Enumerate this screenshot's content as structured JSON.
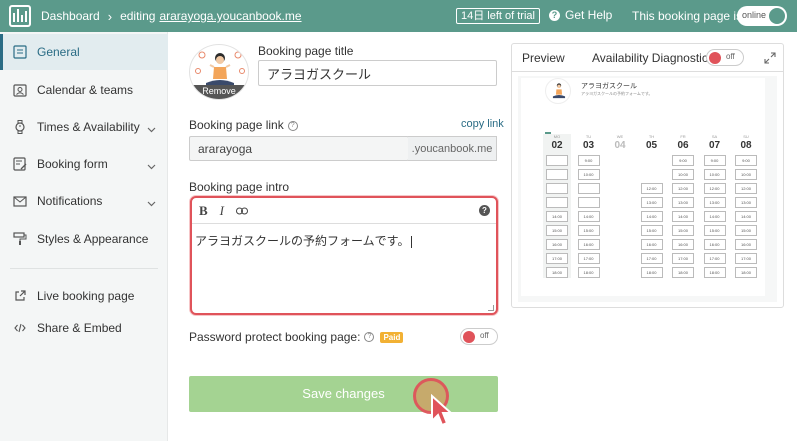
{
  "topbar": {
    "dashboard": "Dashboard",
    "editing": "editing",
    "site": "ararayoga.youcanbook.me",
    "trial": "14日 left of trial",
    "help": "Get Help",
    "booking_page_is": "This booking page is",
    "online": "online"
  },
  "sidebar": {
    "items": [
      {
        "label": "General"
      },
      {
        "label": "Calendar & teams"
      },
      {
        "label": "Times & Availability"
      },
      {
        "label": "Booking form"
      },
      {
        "label": "Notifications"
      },
      {
        "label": "Styles & Appearance"
      },
      {
        "label": "Live booking page"
      },
      {
        "label": "Share & Embed"
      }
    ]
  },
  "form": {
    "remove": "Remove",
    "title_label": "Booking page title",
    "title_value": "アラヨガスクール",
    "link_label": "Booking page link",
    "copy_link": "copy link",
    "link_value": "ararayoga",
    "link_suffix": ".youcanbook.me",
    "intro_label": "Booking page intro",
    "intro_text": "アラヨガスクールの予約フォームです。",
    "password_label": "Password protect booking page:",
    "paid": "Paid",
    "password_toggle": "off",
    "save": "Save changes"
  },
  "preview": {
    "tab": "Preview",
    "diagnostics": "Availability Diagnostics",
    "diagnostics_toggle": "off",
    "page_title": "アラヨガスクール",
    "page_sub": "アラヨガスクールの予約フォームです。",
    "days": [
      {
        "dow": "MO",
        "day": "02",
        "slots": [
          "",
          "",
          "",
          "",
          "14:00",
          "15:00",
          "16:00",
          "17:00",
          "18:00"
        ]
      },
      {
        "dow": "TU",
        "day": "03",
        "slots": [
          "9:00",
          "10:00",
          "",
          "",
          "14:00",
          "15:00",
          "16:00",
          "17:00",
          "18:00"
        ]
      },
      {
        "dow": "WE",
        "day": "04",
        "slots": [
          "",
          "",
          "",
          "",
          "",
          "",
          "",
          "",
          ""
        ]
      },
      {
        "dow": "TH",
        "day": "05",
        "slots": [
          "",
          "",
          "12:00",
          "13:00",
          "14:00",
          "15:00",
          "16:00",
          "17:00",
          "18:00"
        ]
      },
      {
        "dow": "FR",
        "day": "06",
        "slots": [
          "9:00",
          "10:00",
          "12:00",
          "13:00",
          "14:00",
          "15:00",
          "16:00",
          "17:00",
          "18:00"
        ]
      },
      {
        "dow": "SA",
        "day": "07",
        "slots": [
          "9:00",
          "10:00",
          "12:00",
          "13:00",
          "14:00",
          "15:00",
          "16:00",
          "17:00",
          "18:00"
        ]
      },
      {
        "dow": "SU",
        "day": "08",
        "slots": [
          "9:00",
          "10:00",
          "12:00",
          "13:00",
          "14:00",
          "15:00",
          "16:00",
          "17:00",
          "18:00"
        ]
      }
    ]
  }
}
